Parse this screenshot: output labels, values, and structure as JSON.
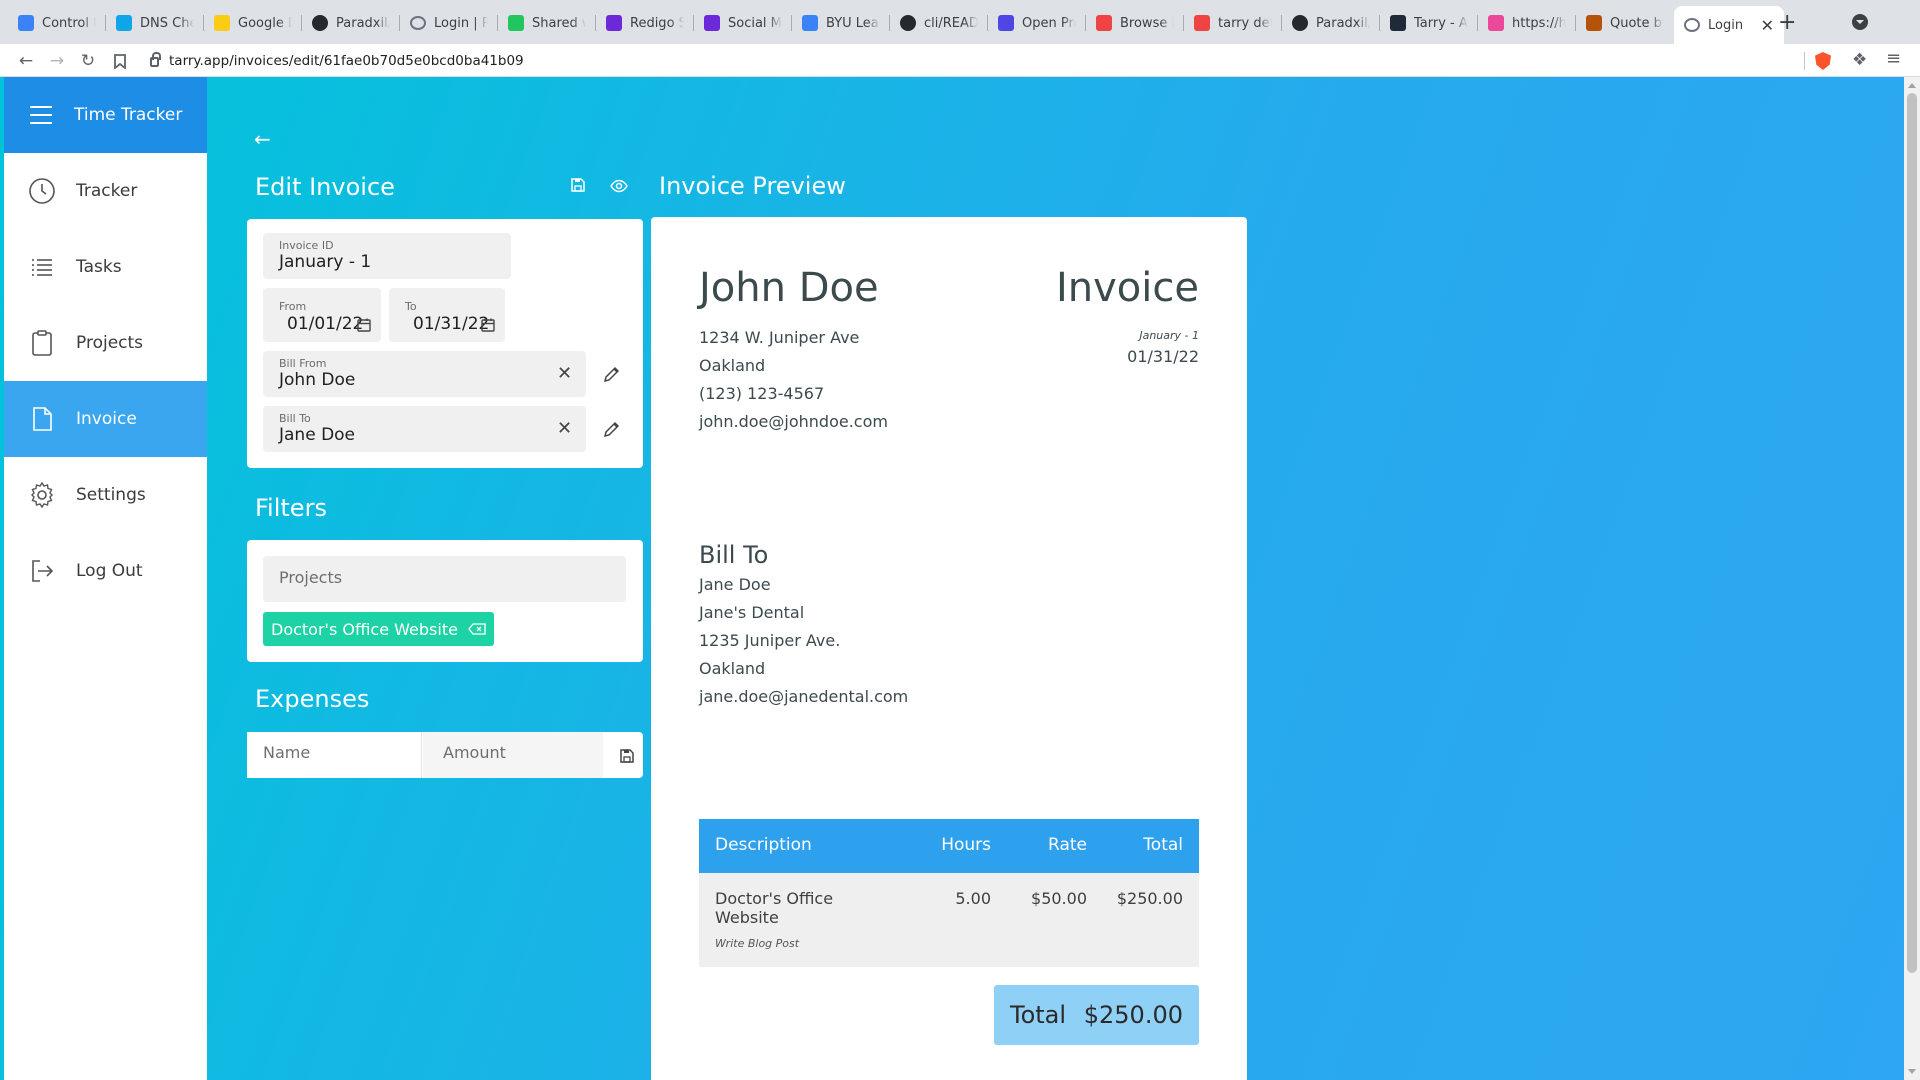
{
  "browser": {
    "tabs": [
      {
        "title": "Control Pa",
        "icon": "control-panel-icon",
        "color": "#3b82f6"
      },
      {
        "title": "DNS Check",
        "icon": "shield-icon",
        "color": "#0ea5e9"
      },
      {
        "title": "Google Do",
        "icon": "google-docs-icon",
        "color": "#facc15"
      },
      {
        "title": "Paradxil/t",
        "icon": "github-icon",
        "color": "#24292e"
      },
      {
        "title": "Login | Pa",
        "icon": "globe-icon",
        "color": "#6b7280"
      },
      {
        "title": "Shared wi",
        "icon": "google-drive-icon",
        "color": "#22c55e"
      },
      {
        "title": "Redigo So",
        "icon": "app-icon",
        "color": "#6d28d9"
      },
      {
        "title": "Social Med",
        "icon": "app-icon",
        "color": "#6d28d9"
      },
      {
        "title": "BYU Learn",
        "icon": "byu-icon",
        "color": "#3b82f6"
      },
      {
        "title": "cli/READM",
        "icon": "github-icon",
        "color": "#24292e"
      },
      {
        "title": "Open Prop",
        "icon": "open-project-icon",
        "color": "#4f46e5"
      },
      {
        "title": "Browse Fo",
        "icon": "grid-icon",
        "color": "#ef4444"
      },
      {
        "title": "tarry defin",
        "icon": "search-icon",
        "color": "#ef4444"
      },
      {
        "title": "Paradxil/t",
        "icon": "github-icon",
        "color": "#24292e"
      },
      {
        "title": "Tarry - An",
        "icon": "react-icon",
        "color": "#1f2937"
      },
      {
        "title": "https://hu",
        "icon": "figma-icon",
        "color": "#ec4899"
      },
      {
        "title": "Quote by",
        "icon": "goodreads-icon",
        "color": "#b45309"
      },
      {
        "title": "Login",
        "icon": "globe-icon",
        "color": "#6b7280",
        "active": true
      }
    ],
    "url": "tarry.app/invoices/edit/61fae0b70d5e0bcd0ba41b09"
  },
  "sidebar": {
    "app_title": "Time Tracker",
    "items": [
      {
        "label": "Tracker",
        "icon": "clock-icon"
      },
      {
        "label": "Tasks",
        "icon": "list-icon"
      },
      {
        "label": "Projects",
        "icon": "clipboard-icon"
      },
      {
        "label": "Invoice",
        "icon": "file-icon",
        "active": true
      },
      {
        "label": "Settings",
        "icon": "gear-icon"
      },
      {
        "label": "Log Out",
        "icon": "logout-icon"
      }
    ]
  },
  "edit": {
    "title": "Edit Invoice",
    "invoice_id_label": "Invoice ID",
    "invoice_id": "January - 1",
    "from_label": "From",
    "from_date": "01/01/22",
    "to_label": "To",
    "to_date": "01/31/22",
    "bill_from_label": "Bill From",
    "bill_from": "John Doe",
    "bill_to_label": "Bill To",
    "bill_to": "Jane Doe"
  },
  "filters": {
    "title": "Filters",
    "projects_placeholder": "Projects",
    "chip_label": "Doctor's Office Website"
  },
  "expenses": {
    "title": "Expenses",
    "name_placeholder": "Name",
    "amount_placeholder": "Amount"
  },
  "preview": {
    "title": "Invoice Preview",
    "from_name": "John Doe",
    "heading": "Invoice",
    "invoice_id": "January - 1",
    "date": "01/31/22",
    "from_lines": [
      "1234 W. Juniper Ave",
      "Oakland",
      "(123) 123-4567",
      "john.doe@johndoe.com"
    ],
    "bill_to_label": "Bill To",
    "bill_to_lines": [
      "Jane Doe",
      "Jane's Dental",
      "1235 Juniper Ave.",
      "Oakland",
      "jane.doe@janedental.com"
    ],
    "table": {
      "headers": [
        "Description",
        "Hours",
        "Rate",
        "Total"
      ],
      "rows": [
        {
          "description": "Doctor's Office Website",
          "task": "Write Blog Post",
          "hours": "5.00",
          "rate": "$50.00",
          "total": "$250.00"
        }
      ]
    },
    "total_label": "Total",
    "total_value": "$250.00"
  }
}
